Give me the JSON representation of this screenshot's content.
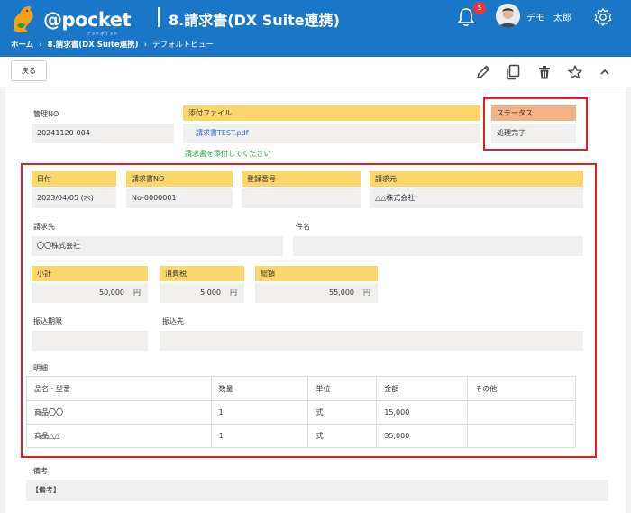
{
  "appbar": {
    "logo_text": "@pocket",
    "logo_sub": "アットポケット",
    "title": "8.請求書(DX Suite連携)",
    "notification_count": "5",
    "user_name": "デモ　太郎"
  },
  "breadcrumb": {
    "home": "ホーム",
    "app": "8.請求書(DX Suite連携)",
    "view": "デフォルトビュー"
  },
  "toolbar": {
    "back_label": "戻る"
  },
  "form": {
    "mgmt_no_label": "管理NO",
    "mgmt_no_value": "20241120-004",
    "attachment_label": "添付ファイル",
    "attachment_file": "請求書TEST.pdf",
    "attachment_note": "請求書を添付してください",
    "status_label": "ステータス",
    "status_value": "処理完了",
    "date_label": "日付",
    "date_value": "2023/04/05 (水)",
    "invoice_no_label": "請求書NO",
    "invoice_no_value": "No-0000001",
    "reg_no_label": "登録番号",
    "reg_no_value": "",
    "issuer_label": "請求元",
    "issuer_value": "△△株式会社",
    "recipient_label": "請求先",
    "recipient_value": "〇〇株式会社",
    "subject_label": "件名",
    "subject_value": "",
    "subtotal_label": "小計",
    "subtotal_value": "50,000",
    "tax_label": "消費税",
    "tax_value": "5,000",
    "total_label": "総額",
    "total_value": "55,000",
    "currency_unit": "円",
    "due_label": "振込期限",
    "due_value": "",
    "payee_label": "振込先",
    "payee_value": "",
    "details_label": "明細",
    "notes_label": "備考",
    "notes_value": "【備考】"
  },
  "details_table": {
    "headers": [
      "品名・型番",
      "数量",
      "単位",
      "金額",
      "その他"
    ],
    "rows": [
      [
        "商品〇〇",
        "1",
        "式",
        "15,000",
        ""
      ],
      [
        "商品△△",
        "1",
        "式",
        "35,000",
        ""
      ]
    ]
  },
  "colors": {
    "appbar": "#1a77c7",
    "label_highlight": "#fcd66b",
    "status_label": "#f4b183",
    "annotation_box": "#e02020",
    "attachment_link": "#3366cc",
    "attachment_note": "#2f9a45"
  },
  "icons": {
    "bell": "bell-icon",
    "gear": "gear-icon",
    "edit": "pencil-icon",
    "copy": "copy-icon",
    "delete": "trash-icon",
    "favorite": "star-icon",
    "collapse": "chevron-up-icon"
  }
}
